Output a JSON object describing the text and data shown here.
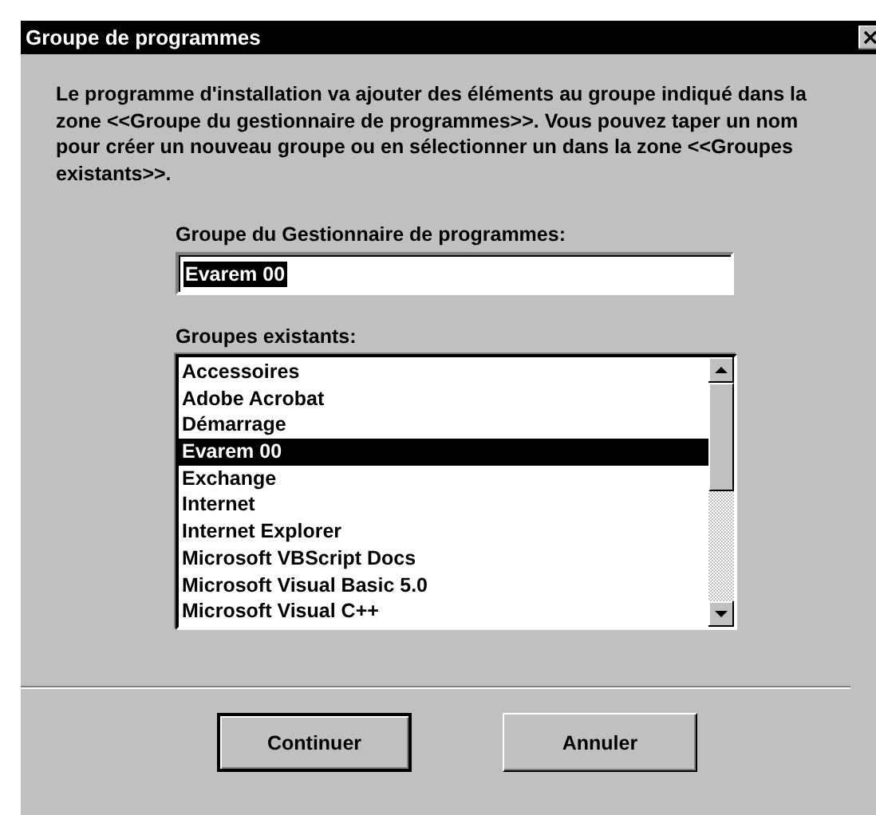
{
  "window": {
    "title": "Groupe de programmes"
  },
  "description": "Le programme d'installation va ajouter des éléments au groupe indiqué dans la zone <<Groupe du gestionnaire de programmes>>. Vous pouvez taper un nom pour créer un nouveau groupe ou en sélectionner un dans la zone <<Groupes existants>>.",
  "group_field": {
    "label": "Groupe du Gestionnaire de programmes:",
    "value": "Evarem 00",
    "highlighted": true
  },
  "existing_groups": {
    "label": "Groupes existants:",
    "items": [
      {
        "label": "Accessoires",
        "selected": false
      },
      {
        "label": "Adobe Acrobat",
        "selected": false
      },
      {
        "label": "Démarrage",
        "selected": false
      },
      {
        "label": "Evarem 00",
        "selected": true
      },
      {
        "label": "Exchange",
        "selected": false
      },
      {
        "label": "Internet",
        "selected": false
      },
      {
        "label": "Internet Explorer",
        "selected": false
      },
      {
        "label": "Microsoft VBScript Docs",
        "selected": false
      },
      {
        "label": "Microsoft Visual Basic 5.0",
        "selected": false
      },
      {
        "label": "Microsoft Visual C++",
        "selected": false
      }
    ]
  },
  "buttons": [
    {
      "label": "Continuer",
      "default": true
    },
    {
      "label": "Annuler",
      "default": false
    }
  ]
}
